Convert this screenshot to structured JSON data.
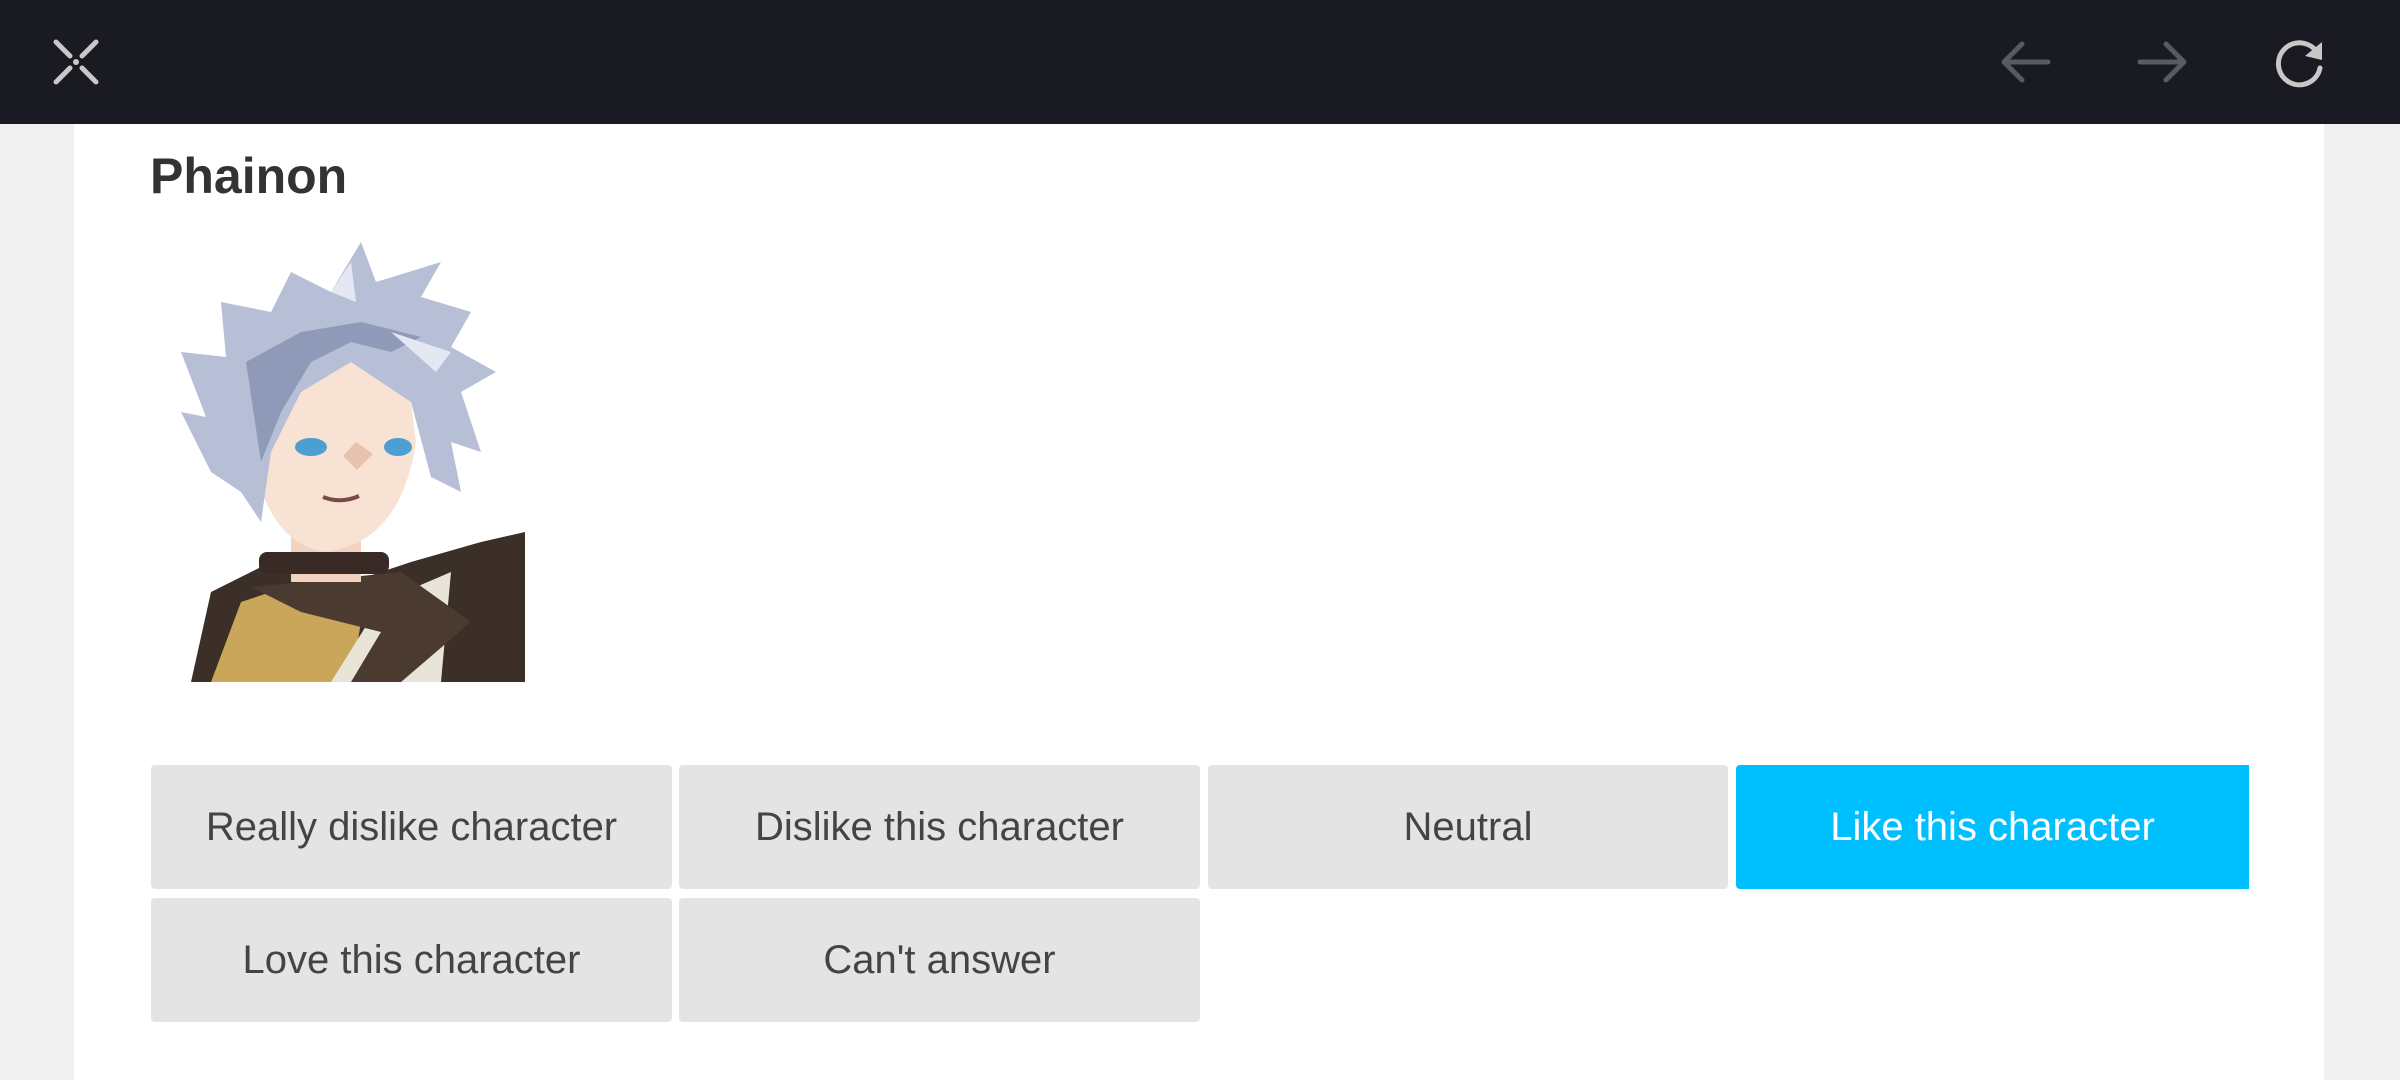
{
  "toolbar": {
    "close_icon": "close-x-icon",
    "back_icon": "arrow-left-icon",
    "forward_icon": "arrow-right-icon",
    "reload_icon": "reload-icon"
  },
  "character": {
    "name": "Phainon",
    "portrait_description_icon": "character-portrait"
  },
  "options": [
    {
      "label": "Really dislike character",
      "selected": false
    },
    {
      "label": "Dislike this character",
      "selected": false
    },
    {
      "label": "Neutral",
      "selected": false
    },
    {
      "label": "Like this character",
      "selected": true
    },
    {
      "label": "Love this character",
      "selected": false
    },
    {
      "label": "Can't answer",
      "selected": false
    }
  ],
  "colors": {
    "topbar": "#1a1a22",
    "selected": "#00bfff",
    "option_bg": "#e4e4e4",
    "page_bg": "#f0f0f0"
  }
}
